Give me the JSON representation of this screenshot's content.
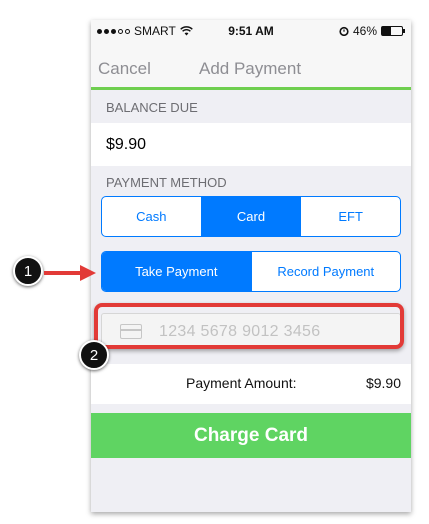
{
  "status_bar": {
    "carrier": "SMART",
    "time": "9:51 AM",
    "battery_percent": "46%",
    "battery_level": 0.46,
    "icons": [
      "signal-dots-icon",
      "wifi-icon",
      "alarm-icon",
      "battery-icon"
    ]
  },
  "nav": {
    "cancel_label": "Cancel",
    "title": "Add Payment",
    "accent_color": "#6fcf4f"
  },
  "balance": {
    "header": "BALANCE DUE",
    "value": "$9.90"
  },
  "payment_method": {
    "header": "PAYMENT METHOD",
    "options": [
      {
        "label": "Cash",
        "selected": false
      },
      {
        "label": "Card",
        "selected": true
      },
      {
        "label": "EFT",
        "selected": false
      }
    ],
    "modes": [
      {
        "label": "Take Payment",
        "selected": true
      },
      {
        "label": "Record Payment",
        "selected": false
      }
    ],
    "selected_color": "#007aff"
  },
  "card_input": {
    "icon": "credit-card-icon",
    "placeholder": "1234 5678 9012 3456"
  },
  "amount": {
    "label": "Payment Amount:",
    "value": "$9.90"
  },
  "charge_button": {
    "label": "Charge Card",
    "color": "#5fd462"
  },
  "annotations": {
    "callout_1": "1",
    "callout_2": "2",
    "highlight_color": "#e23a37"
  }
}
